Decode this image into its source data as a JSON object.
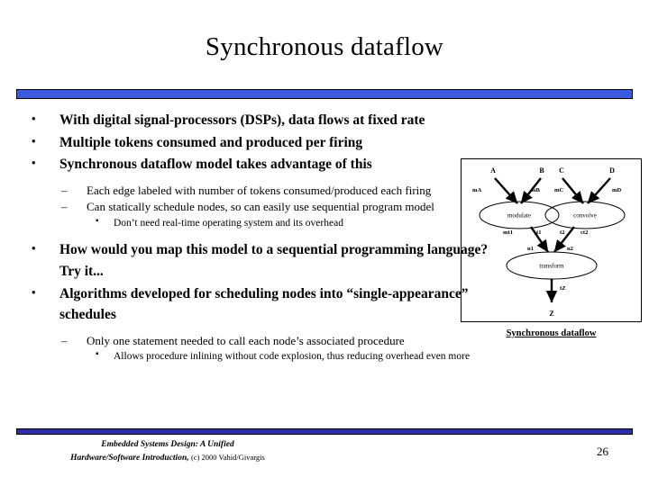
{
  "slide": {
    "title": "Synchronous dataflow",
    "page_number": "26",
    "accent_color_top": "#3A5BE0",
    "accent_color_bottom": "#2D2DA5"
  },
  "bullets": {
    "level1_marker": "•",
    "level2_marker": "–",
    "level3_marker": "▪",
    "items": [
      {
        "level": 1,
        "text": "With digital signal-processors (DSPs), data flows at fixed rate"
      },
      {
        "level": 1,
        "text": "Multiple tokens consumed and produced per firing"
      },
      {
        "level": 1,
        "text": "Synchronous dataflow model takes advantage of this"
      },
      {
        "level": 2,
        "text": "Each edge labeled with number of tokens consumed/produced each firing"
      },
      {
        "level": 2,
        "text": "Can statically schedule nodes, so can easily use sequential program model"
      },
      {
        "level": 3,
        "text": "Don’t need real-time operating system and its overhead"
      },
      {
        "level": 1,
        "text": "How would you map this model to a sequential programming language? Try it..."
      },
      {
        "level": 1,
        "text": "Algorithms developed for scheduling nodes into “single-appearance” schedules"
      },
      {
        "level": 2,
        "text": "Only one statement needed to call each node’s associated procedure"
      },
      {
        "level": 3,
        "text": "Allows procedure inlining without code explosion, thus reducing overhead even more"
      }
    ]
  },
  "figure": {
    "caption": "Synchronous dataflow",
    "sources": [
      "A",
      "B",
      "C",
      "D"
    ],
    "nodes": [
      "modulate",
      "convolve",
      "transform"
    ],
    "sink": "Z",
    "edge_labels": {
      "a_to_modulate": "mA",
      "b_to_modulate": "mB",
      "c_to_convolve": "mC",
      "d_to_convolve": "mD",
      "modulate_out": "mt1",
      "modulate_to_transform": "t1",
      "convolve_out": "t2",
      "convolve_to_transform": "ct2",
      "transform_in_left": "n1",
      "transform_in_right": "n2",
      "transform_out": "tZ"
    }
  },
  "footer": {
    "line1": "Embedded Systems Design: A Unified",
    "line2": "Hardware/Software Introduction,",
    "copyright": "(c) 2000 Vahid/Givargis"
  }
}
